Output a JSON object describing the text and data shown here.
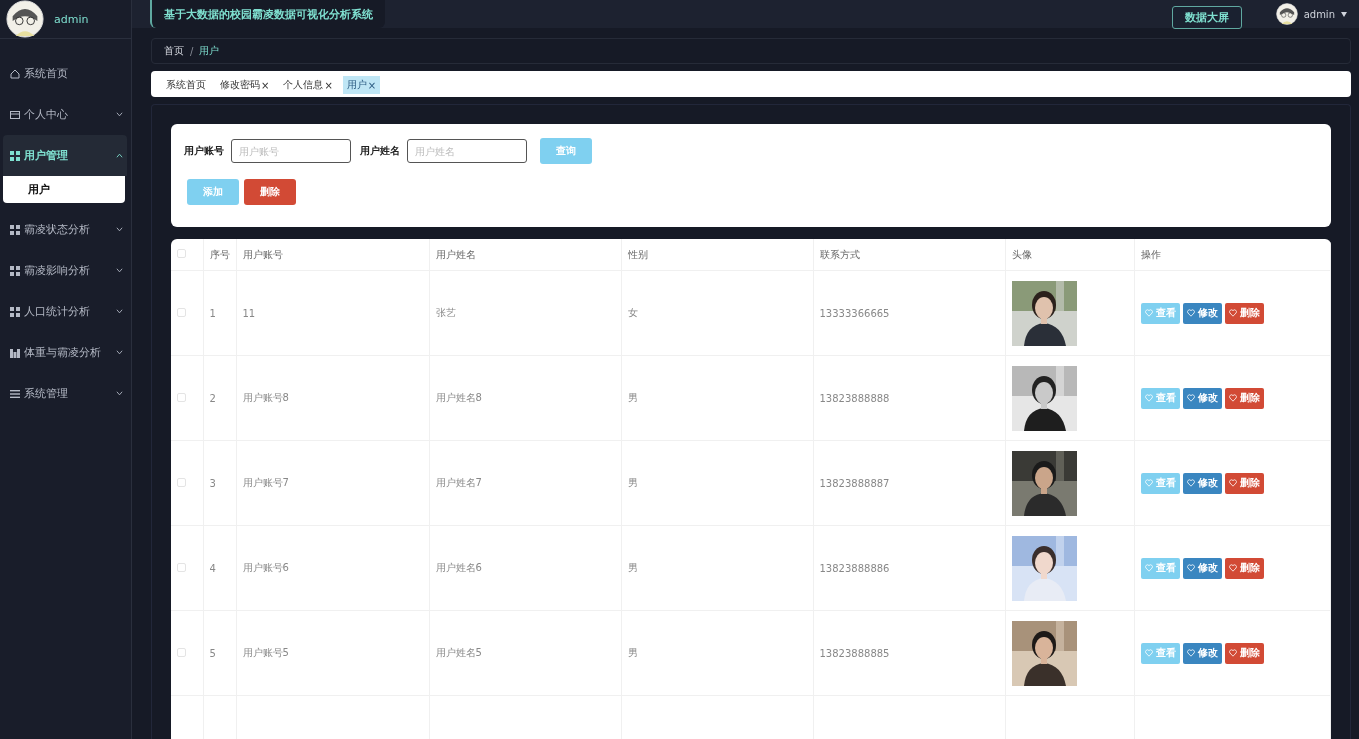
{
  "sidebar": {
    "user": "admin",
    "items": [
      {
        "label": "系统首页",
        "kind": "home",
        "expanded": false
      },
      {
        "label": "个人中心",
        "kind": "card",
        "expanded": false
      },
      {
        "label": "用户管理",
        "kind": "grid",
        "expanded": true,
        "children": [
          {
            "label": "用户",
            "selected": true
          }
        ]
      },
      {
        "label": "霸凌状态分析",
        "kind": "grid",
        "expanded": false
      },
      {
        "label": "霸凌影响分析",
        "kind": "grid",
        "expanded": false
      },
      {
        "label": "人口统计分析",
        "kind": "grid",
        "expanded": false
      },
      {
        "label": "体重与霸凌分析",
        "kind": "bars",
        "expanded": false
      },
      {
        "label": "系统管理",
        "kind": "list",
        "expanded": false
      }
    ]
  },
  "header": {
    "title": "基于大数据的校园霸凌数据可视化分析系统",
    "screen_button": "数据大屏",
    "user": "admin"
  },
  "breadcrumb": {
    "items": [
      "首页",
      "用户"
    ],
    "separator": "/"
  },
  "tabs": [
    {
      "label": "系统首页",
      "selected": false
    },
    {
      "label": "修改密码",
      "close": "×",
      "selected": false
    },
    {
      "label": "个人信息",
      "close": "×",
      "selected": false
    },
    {
      "label": "用户",
      "close": "×",
      "selected": true
    }
  ],
  "search": {
    "fields": [
      {
        "label": "用户账号",
        "placeholder": "用户账号"
      },
      {
        "label": "用户姓名",
        "placeholder": "用户姓名"
      }
    ],
    "query_button": "查询",
    "add_button": "添加",
    "delete_button": "删除"
  },
  "table": {
    "columns": [
      "序号",
      "用户账号",
      "用户姓名",
      "性别",
      "联系方式",
      "头像",
      "操作"
    ],
    "all_checked": false,
    "rows": [
      {
        "index": "1",
        "account": "11",
        "name": "张艺",
        "gender": "女",
        "phone": "13333366665",
        "checked": false,
        "photo": {
          "kind": "picture"
        },
        "actions": [
          "查看",
          "修改",
          "删除"
        ]
      },
      {
        "index": "2",
        "account": "用户账号8",
        "name": "用户姓名8",
        "gender": "男",
        "phone": "13823888888",
        "checked": false,
        "photo": {
          "kind": "picture"
        },
        "actions": [
          "查看",
          "修改",
          "删除"
        ]
      },
      {
        "index": "3",
        "account": "用户账号7",
        "name": "用户姓名7",
        "gender": "男",
        "phone": "13823888887",
        "checked": false,
        "photo": {
          "kind": "picture"
        },
        "actions": [
          "查看",
          "修改",
          "删除"
        ]
      },
      {
        "index": "4",
        "account": "用户账号6",
        "name": "用户姓名6",
        "gender": "男",
        "phone": "13823888886",
        "checked": false,
        "photo": {
          "kind": "picture"
        },
        "actions": [
          "查看",
          "修改",
          "删除"
        ]
      },
      {
        "index": "5",
        "account": "用户账号5",
        "name": "用户姓名5",
        "gender": "男",
        "phone": "13823888885",
        "checked": false,
        "photo": {
          "kind": "picture"
        },
        "actions": [
          "查看",
          "修改",
          "删除"
        ]
      }
    ]
  }
}
